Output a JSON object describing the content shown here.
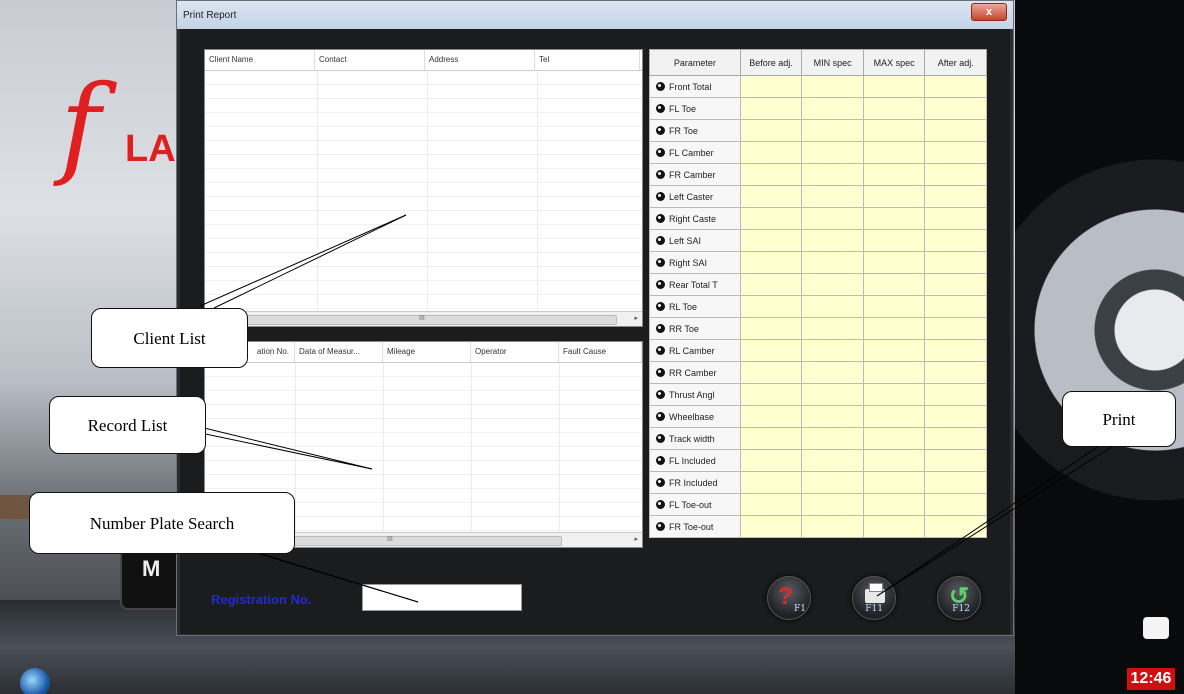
{
  "window": {
    "title": "Print Report",
    "close_glyph": "x"
  },
  "background": {
    "logo_letter": "f",
    "logo_text": "LA",
    "badge_text": "M",
    "clock": "12:46"
  },
  "client_list": {
    "columns": [
      "Client Name",
      "Contact",
      "Address",
      "Tel"
    ],
    "scroll_grip": "III",
    "scroll_arrow": "▸"
  },
  "record_list": {
    "columns": [
      "ation No.",
      "Data of Measur...",
      "Mileage",
      "Operator",
      "Fault Cause"
    ],
    "scroll_grip": "III",
    "scroll_arrow": "▸"
  },
  "param_table": {
    "headers": [
      "Parameter",
      "Before adj.",
      "MIN spec",
      "MAX spec",
      "After adj."
    ],
    "rows": [
      "Front Total",
      "FL Toe",
      "FR Toe",
      "FL Camber",
      "FR Camber",
      "Left Caster",
      "Right Caste",
      "Left SAI",
      "Right SAI",
      "Rear Total T",
      "RL Toe",
      "RR Toe",
      "RL Camber",
      "RR Camber",
      "Thrust Angl",
      "Wheelbase",
      "Track width",
      "FL Included",
      "FR Included",
      "FL Toe-out",
      "FR Toe-out"
    ]
  },
  "search": {
    "label": "Registration No.",
    "value": ""
  },
  "buttons": {
    "help_key": "F1",
    "print_key": "F11",
    "back_key": "F12"
  },
  "callouts": {
    "client_list": "Client List",
    "record_list": "Record List",
    "number_plate": "Number Plate Search",
    "print": "Print"
  },
  "colors": {
    "value_cell": "#ffffd0",
    "registration_label": "#1f2ad8",
    "accent_red": "#e02020"
  },
  "icons": [
    "help-icon",
    "printer-icon",
    "back-icon",
    "close-icon",
    "windows-start-icon"
  ]
}
